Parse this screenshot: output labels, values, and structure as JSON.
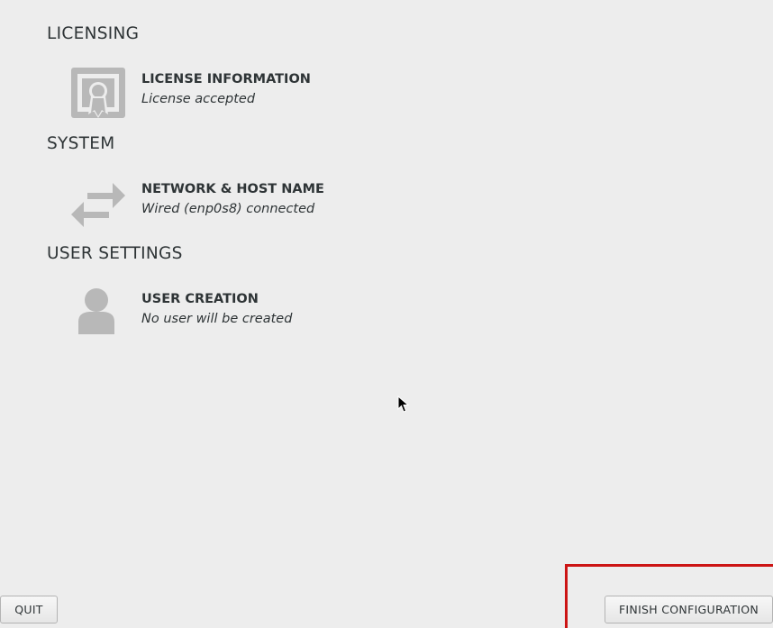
{
  "sections": {
    "licensing": {
      "title": "LICENSING",
      "spoke": {
        "name": "LICENSE INFORMATION",
        "status": "License accepted",
        "icon": "license-certificate-icon"
      }
    },
    "system": {
      "title": "SYSTEM",
      "spoke": {
        "name": "NETWORK & HOST NAME",
        "status": "Wired (enp0s8) connected",
        "icon": "network-arrows-icon"
      }
    },
    "user_settings": {
      "title": "USER SETTINGS",
      "spoke": {
        "name": "USER CREATION",
        "status": "No user will be created",
        "icon": "user-icon"
      }
    }
  },
  "buttons": {
    "quit": "QUIT",
    "finish": "FINISH CONFIGURATION"
  },
  "colors": {
    "background": "#ededed",
    "icon_gray": "#b8b8b8",
    "highlight": "#cc1414",
    "text": "#2e3436"
  }
}
